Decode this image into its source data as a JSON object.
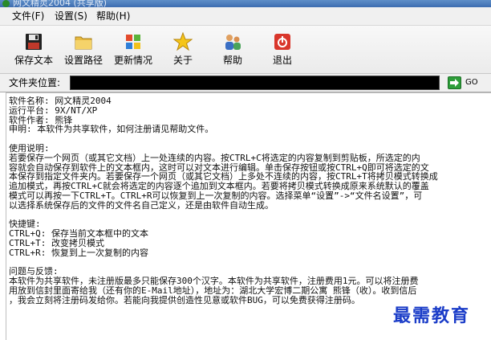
{
  "window": {
    "title": "网文精灵2004 (共享版)"
  },
  "menu": [
    "文件(F)",
    "设置(S)",
    "帮助(H)"
  ],
  "toolbar": [
    {
      "label": "保存文本",
      "icon": "floppy-disk-icon"
    },
    {
      "label": "设置路径",
      "icon": "folder-icon"
    },
    {
      "label": "更新情况",
      "icon": "windows-logo-icon"
    },
    {
      "label": "关于",
      "icon": "star-icon"
    },
    {
      "label": "帮助",
      "icon": "help-people-icon"
    },
    {
      "label": "退出",
      "icon": "exit-power-icon"
    }
  ],
  "address": {
    "label": "文件夹位置:",
    "value": "",
    "go_label": "GO"
  },
  "content": {
    "info": [
      "软件名称: 网文精灵2004",
      "运行平台: 9X/NT/XP",
      "软件作者: 熊锋",
      "申明: 本软件为共享软件，如何注册请见帮助文件。"
    ],
    "usage_title": "使用说明:",
    "usage": [
      "  若要保存一个网页（或其它文档）上一处连续的内容。按CTRL+C将选定的内容复制到剪贴板，所选定的内",
      "容就会自动保存到软件上的文本框内，这时可以对文本进行编辑。单击保存按钮或按CTRL+Q即可将选定的文",
      "本保存到指定文件夹内。若要保存一个网页（或其它文档）上多处不连续的内容，按CTRL+T将拷贝模式转换成",
      "追加模式，再按CTRL+C就会将选定的内容逐个追加到文本框内。若要将拷贝模式转换成原来系统默认的覆盖",
      "模式可以再按一下CTRL+T。CTRL+R可以恢复到上一次复制的内容。选择菜单“设置”->“文件名设置”，可",
      "以选择系统保存后的文件的文件名自己定义，还是由软件自动生成。"
    ],
    "hotkeys_title": "快捷键:",
    "hotkeys": [
      "   CTRL+Q: 保存当前文本框中的文本",
      "   CTRL+T: 改变拷贝模式",
      "   CTRL+R: 恢复到上一次复制的内容"
    ],
    "feedback_title": "问题与反馈:",
    "feedback": [
      "    本软件为共享软件，未注册版最多只能保存300个汉字。本软件为共享软件，注册费用1元。可以将注册费",
      "用放到信封里面寄给我（还有你的E-Mail地址），地址为：湖北大学宏博二期公寓 熊锋（收）。收到信后",
      "，我会立刻将注册码发给你。若能向我提供创造性见意或软件BUG，可以免费获得注册码。"
    ]
  },
  "watermark": "最需教育"
}
